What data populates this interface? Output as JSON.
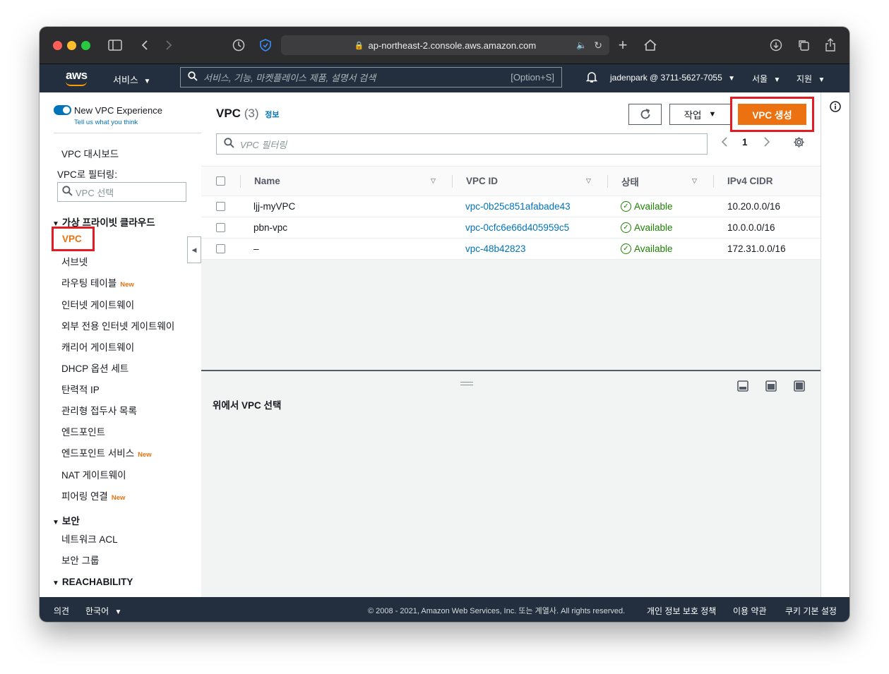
{
  "browser": {
    "url": "ap-northeast-2.console.aws.amazon.com"
  },
  "awsnav": {
    "logo": "aws",
    "services": "서비스",
    "search_placeholder": "서비스, 기능, 마켓플레이스 제품, 설명서 검색",
    "search_shortcut": "[Option+S]",
    "account": "jadenpark @ 3711-5627-7055",
    "region": "서울",
    "support": "지원"
  },
  "sidebar": {
    "toggle_label": "New VPC Experience",
    "toggle_link": "Tell us what you think",
    "dashboard": "VPC 대시보드",
    "filter_label": "VPC로 필터링:",
    "filter_placeholder": "VPC 선택",
    "section_vpc": "가상 프라이빗 클라우드",
    "items": [
      {
        "label": "VPC",
        "new": ""
      },
      {
        "label": "서브넷",
        "new": ""
      },
      {
        "label": "라우팅 테이블",
        "new": "New"
      },
      {
        "label": "인터넷 게이트웨이",
        "new": ""
      },
      {
        "label": "외부 전용 인터넷 게이트웨이",
        "new": ""
      },
      {
        "label": "캐리어 게이트웨이",
        "new": ""
      },
      {
        "label": "DHCP 옵션 세트",
        "new": ""
      },
      {
        "label": "탄력적 IP",
        "new": ""
      },
      {
        "label": "관리형 접두사 목록",
        "new": ""
      },
      {
        "label": "엔드포인트",
        "new": ""
      },
      {
        "label": "엔드포인트 서비스",
        "new": "New"
      },
      {
        "label": "NAT 게이트웨이",
        "new": ""
      },
      {
        "label": "피어링 연결",
        "new": "New"
      }
    ],
    "section_security": "보안",
    "security_items": [
      "네트워크 ACL",
      "보안 그룹"
    ],
    "section_reachability": "REACHABILITY"
  },
  "main": {
    "title": "VPC",
    "count": "(3)",
    "info": "정보",
    "actions": "작업",
    "create": "VPC 생성",
    "filter_placeholder": "VPC 필터링",
    "page": "1",
    "columns": [
      "Name",
      "VPC ID",
      "상태",
      "IPv4 CIDR"
    ],
    "rows": [
      {
        "name": "ljj-myVPC",
        "id": "vpc-0b25c851afabade43",
        "state": "Available",
        "cidr": "10.20.0.0/16"
      },
      {
        "name": "pbn-vpc",
        "id": "vpc-0cfc6e66d405959c5",
        "state": "Available",
        "cidr": "10.0.0.0/16"
      },
      {
        "name": "–",
        "id": "vpc-48b42823",
        "state": "Available",
        "cidr": "172.31.0.0/16"
      }
    ],
    "detail_hint": "위에서 VPC 선택"
  },
  "footer": {
    "feedback": "의견",
    "language": "한국어",
    "copyright": "© 2008 - 2021, Amazon Web Services, Inc. 또는 계열사. All rights reserved.",
    "privacy": "개인 정보 보호 정책",
    "terms": "이용 약관",
    "cookies": "쿠키 기본 설정"
  },
  "colors": {
    "aws_nav": "#232f3e",
    "primary_button": "#ec7211",
    "link": "#0073bb",
    "available": "#1d8102",
    "highlight": "#e31b23"
  }
}
